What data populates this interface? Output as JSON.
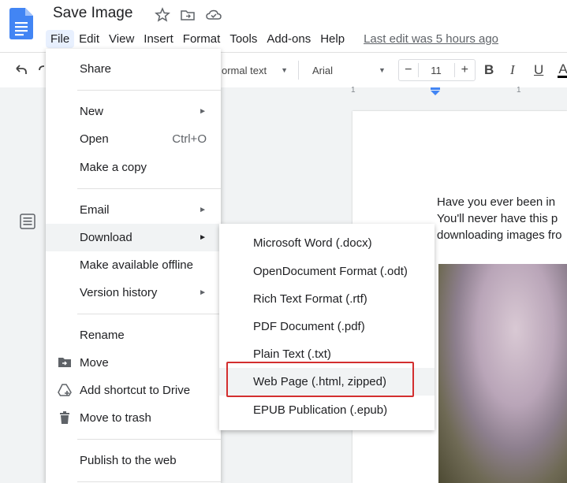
{
  "document": {
    "title": "Save Image",
    "last_edit": "Last edit was 5 hours ago"
  },
  "menubar": {
    "items": [
      "File",
      "Edit",
      "View",
      "Insert",
      "Format",
      "Tools",
      "Add-ons",
      "Help"
    ]
  },
  "toolbar": {
    "style": "ormal text",
    "font": "Arial",
    "font_size": "11",
    "decrease": "−",
    "increase": "+",
    "bold": "B",
    "italic": "I",
    "underline": "U",
    "text_color": "A"
  },
  "ruler": {
    "left_mark": "1",
    "right_mark": "1"
  },
  "page_text": {
    "line1": "Have you ever been in",
    "line2": "You'll never have this p",
    "line3": "downloading images fro"
  },
  "file_menu": {
    "share": "Share",
    "new": "New",
    "open": "Open",
    "open_shortcut": "Ctrl+O",
    "make_copy": "Make a copy",
    "email": "Email",
    "download": "Download",
    "make_offline": "Make available offline",
    "version_history": "Version history",
    "rename": "Rename",
    "move": "Move",
    "add_shortcut": "Add shortcut to Drive",
    "move_trash": "Move to trash",
    "publish": "Publish to the web",
    "arrow": "►"
  },
  "download_menu": {
    "docx": "Microsoft Word (.docx)",
    "odt": "OpenDocument Format (.odt)",
    "rtf": "Rich Text Format (.rtf)",
    "pdf": "PDF Document (.pdf)",
    "txt": "Plain Text (.txt)",
    "html": "Web Page (.html, zipped)",
    "epub": "EPUB Publication (.epub)"
  },
  "colors": {
    "docs_blue": "#4285f4",
    "highlight_red": "#d32f2f",
    "ruler_marker": "#4285f4"
  }
}
